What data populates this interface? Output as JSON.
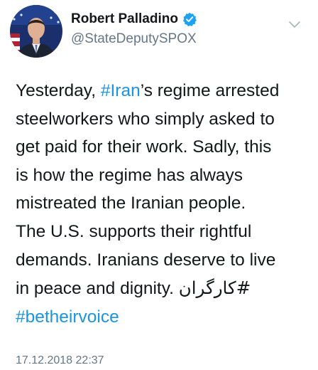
{
  "user": {
    "display_name": "Robert Palladino",
    "handle": "@StateDeputySPOX",
    "verified": true
  },
  "tweet": {
    "lines": [
      {
        "pre": "Yesterday, ",
        "tag": "#Iran",
        "post": "’s regime arrested"
      },
      {
        "text": "steelworkers who simply asked to"
      },
      {
        "text": "get paid for their work. Sadly, this"
      },
      {
        "text": "is how the regime has always"
      },
      {
        "text": "mistreated the Iranian people."
      },
      {
        "text": "The U.S. supports their rightful"
      },
      {
        "text": "demands. Iranians deserve to live"
      },
      {
        "pre": "in peace and dignity. ",
        "tag": "#کارگران"
      },
      {
        "tag": "#betheirvoice"
      }
    ]
  },
  "timestamp": "17.12.2018 22:37",
  "colors": {
    "link": "#1b95e0",
    "verified_badge": "#1da1f2",
    "secondary_text": "#657786",
    "primary_text": "#14171a"
  },
  "icons": {
    "verified": "verified-badge-icon",
    "menu": "chevron-down-icon"
  }
}
